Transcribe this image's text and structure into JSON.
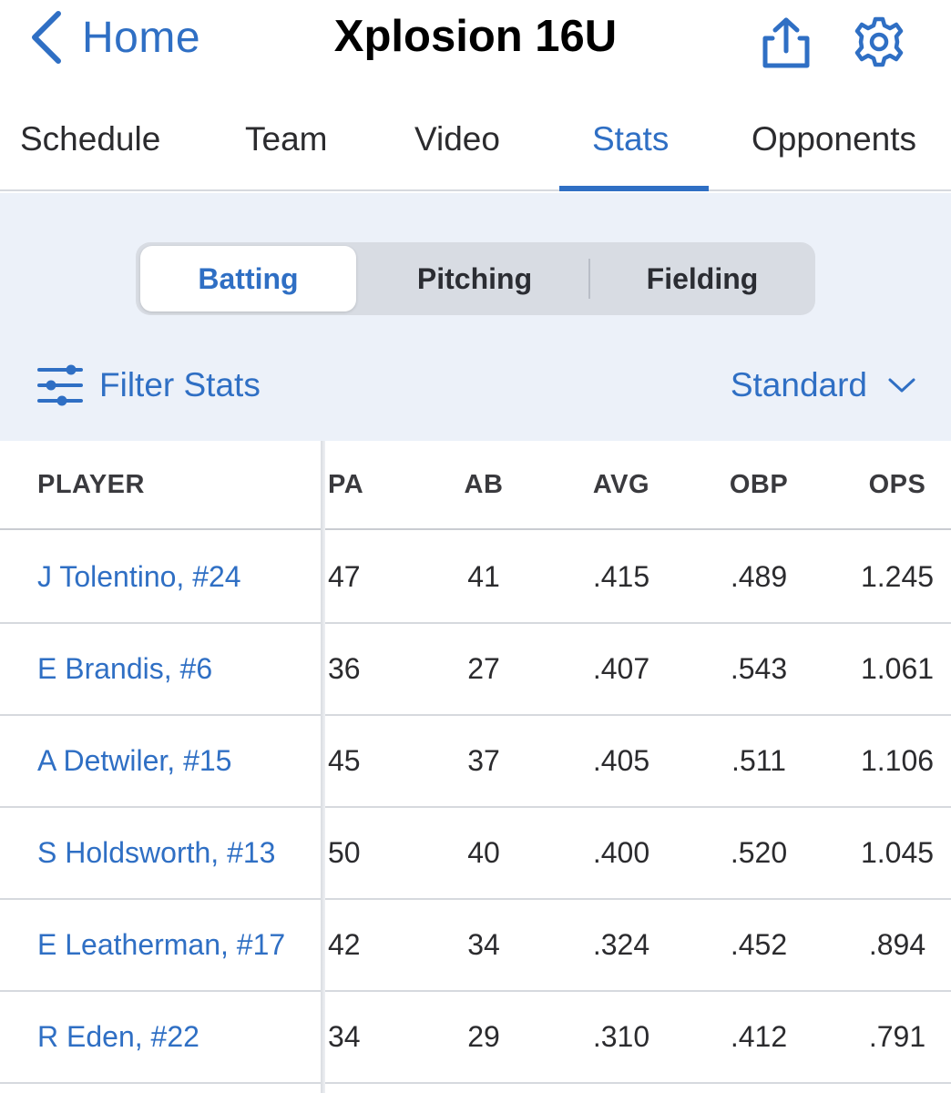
{
  "header": {
    "back_label": "Home",
    "title": "Xplosion 16U",
    "icons": [
      "chevron-left-icon",
      "share-icon",
      "gear-icon"
    ]
  },
  "tabs": [
    {
      "label": "Schedule",
      "active": false
    },
    {
      "label": "Team",
      "active": false
    },
    {
      "label": "Video",
      "active": false
    },
    {
      "label": "Stats",
      "active": true
    },
    {
      "label": "Opponents",
      "active": false
    }
  ],
  "stat_types": [
    {
      "label": "Batting",
      "active": true
    },
    {
      "label": "Pitching",
      "active": false
    },
    {
      "label": "Fielding",
      "active": false
    }
  ],
  "filter": {
    "label": "Filter Stats",
    "icon": "sliders-icon"
  },
  "view_select": {
    "value": "Standard",
    "icon": "chevron-down-icon"
  },
  "table": {
    "columns": [
      "PLAYER",
      "PA",
      "AB",
      "AVG",
      "OBP",
      "OPS"
    ],
    "rows": [
      {
        "player": "J Tolentino, #24",
        "pa": "47",
        "ab": "41",
        "avg": ".415",
        "obp": ".489",
        "ops": "1.245"
      },
      {
        "player": "E Brandis, #6",
        "pa": "36",
        "ab": "27",
        "avg": ".407",
        "obp": ".543",
        "ops": "1.061"
      },
      {
        "player": "A Detwiler, #15",
        "pa": "45",
        "ab": "37",
        "avg": ".405",
        "obp": ".511",
        "ops": "1.106"
      },
      {
        "player": "S Holdsworth, #13",
        "pa": "50",
        "ab": "40",
        "avg": ".400",
        "obp": ".520",
        "ops": "1.045"
      },
      {
        "player": "E Leatherman, #17",
        "pa": "42",
        "ab": "34",
        "avg": ".324",
        "obp": ".452",
        "ops": ".894"
      },
      {
        "player": "R Eden, #22",
        "pa": "34",
        "ab": "29",
        "avg": ".310",
        "obp": ".412",
        "ops": ".791"
      }
    ]
  },
  "colors": {
    "accent": "#2f6fc4",
    "panel": "#ecf1f9",
    "segment_bg": "#d8dce3"
  }
}
